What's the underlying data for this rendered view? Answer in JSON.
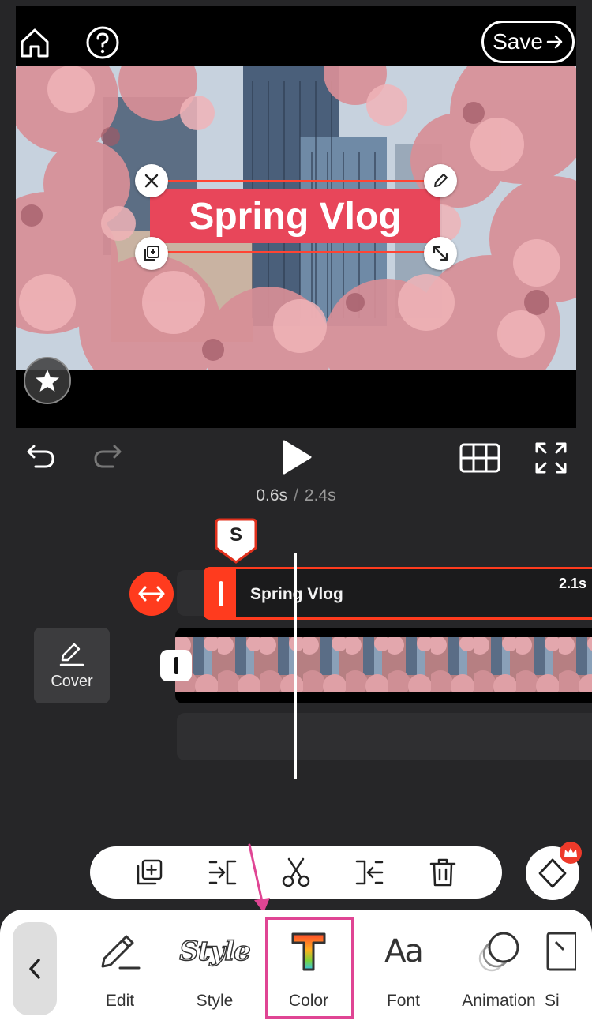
{
  "app": {
    "save_label": "Save"
  },
  "preview": {
    "overlay_text": "Spring Vlog"
  },
  "playback": {
    "current_time": "0.6s",
    "separator": "/",
    "total_time": "2.4s"
  },
  "timeline": {
    "marker_letter": "S",
    "text_clip_title": "Spring Vlog",
    "text_clip_duration": "2.1s",
    "cover_label": "Cover"
  },
  "tools": {
    "edit": "Edit",
    "style": "Style",
    "style_icon_text": "Style",
    "color": "Color",
    "font": "Font",
    "font_icon_text": "Aa",
    "animation": "Animation",
    "sticker": "Si"
  },
  "colors": {
    "accent": "#ff3b1e",
    "title_bg": "#e8465a",
    "highlight": "#e04594"
  },
  "icons": [
    "home-icon",
    "help-icon",
    "arrow-right-icon",
    "close-icon",
    "pencil-icon",
    "duplicate-icon",
    "resize-icon",
    "star-icon",
    "undo-icon",
    "redo-icon",
    "play-icon",
    "grid-icon",
    "fullscreen-icon",
    "swap-icon",
    "copy-icon",
    "trim-left-icon",
    "scissors-icon",
    "trim-right-icon",
    "trash-icon",
    "keyframe-icon",
    "crown-icon",
    "chevron-left-icon"
  ]
}
